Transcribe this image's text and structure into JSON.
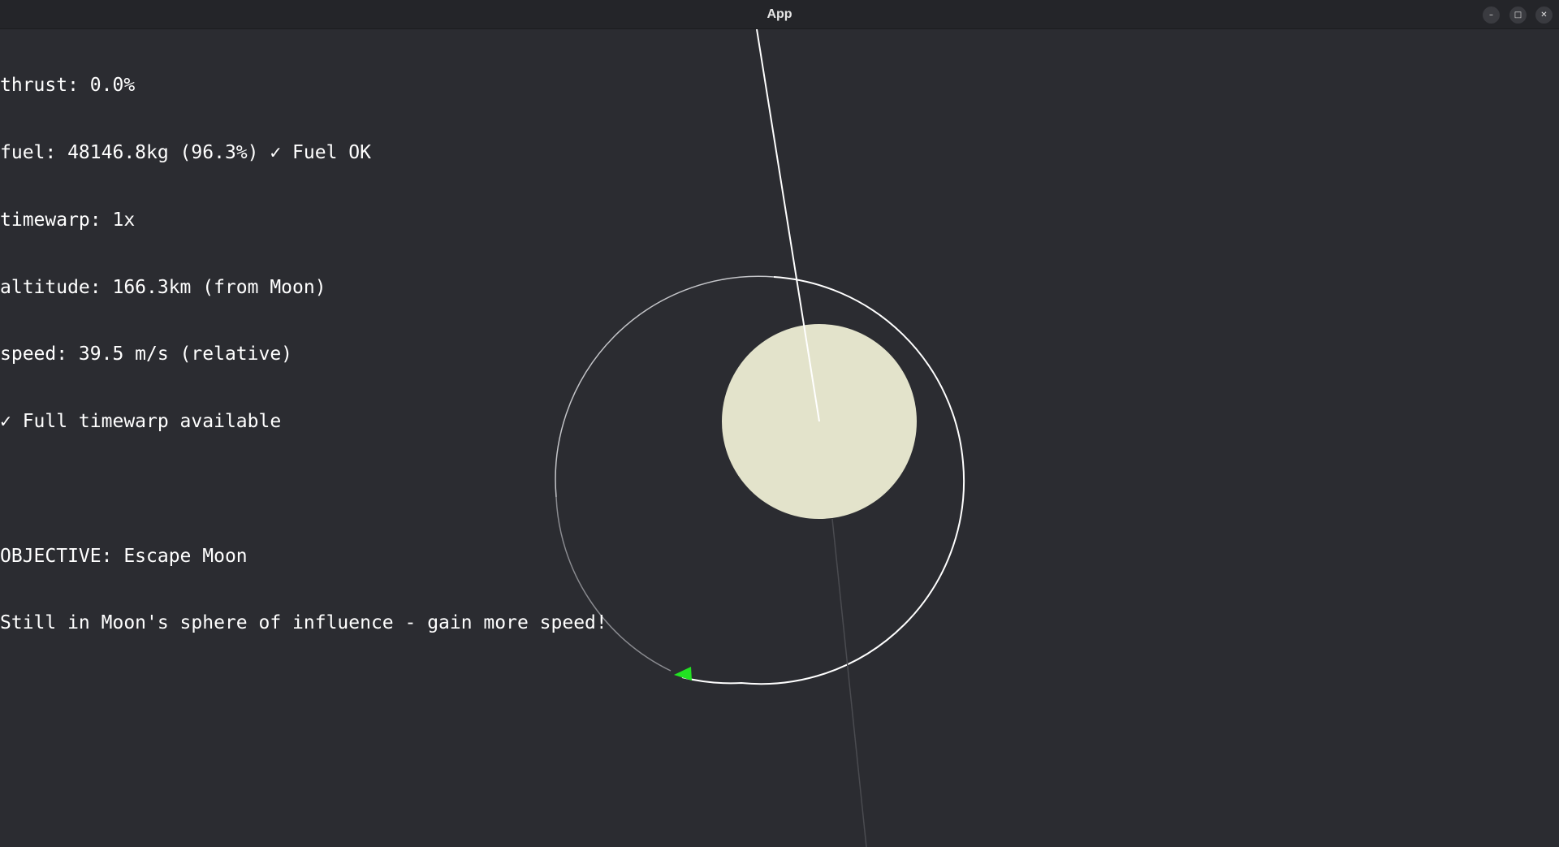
{
  "window": {
    "title": "App",
    "controls": {
      "minimize_icon": "minimize-icon",
      "maximize_icon": "maximize-icon",
      "close_icon": "close-icon"
    }
  },
  "hud": {
    "thrust": "thrust: 0.0%",
    "fuel": "fuel: 48146.8kg (96.3%) ✓ Fuel OK",
    "timewarp": "timewarp: 1x",
    "altitude": "altitude: 166.3km (from Moon)",
    "speed": "speed: 39.5 m/s (relative)",
    "timewarp_status": "✓ Full timewarp available",
    "objective": "OBJECTIVE: Escape Moon",
    "objective_status": "Still in Moon's sphere of influence - gain more speed!"
  },
  "scene": {
    "background_color": "#2b2c31",
    "moon_color": "#e3e3cb",
    "orbit_color": "#ffffff",
    "ship_color": "#22e322"
  }
}
